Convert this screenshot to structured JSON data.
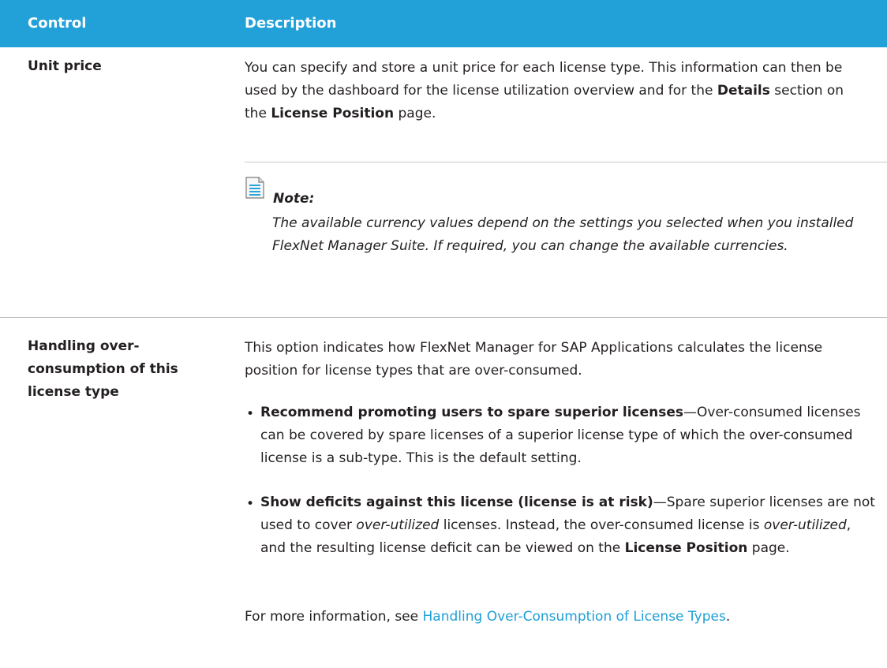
{
  "header": {
    "col_control": "Control",
    "col_description": "Description"
  },
  "row1": {
    "label": "Unit price",
    "desc_part1": "You can specify and store a unit price for each license type. This information can then be used by the dashboard for the license utilization overview and for the ",
    "desc_bold1": "Details",
    "desc_part2": " section on the ",
    "desc_bold2": "License Position",
    "desc_part3": " page.",
    "note": {
      "icon": "note-icon",
      "title": "Note:",
      "body": "The available currency values depend on the settings you selected when you installed FlexNet Manager Suite. If required, you can change the available currencies."
    }
  },
  "row2": {
    "label": "Handling over-consumption of this license type",
    "desc": "This option indicates how FlexNet Manager for SAP Applications calculates the license position for license types that are over-consumed.",
    "bullets": [
      {
        "bold": "Recommend promoting users to spare superior licenses",
        "text": "—Over-consumed licenses can be covered by spare licenses of a superior license type of which the over-consumed license is a sub-type. This is the default setting."
      },
      {
        "bold": "Show deficits against this license (license is at risk)",
        "text_a": "—Spare superior licenses are not used to cover ",
        "italic_a": "over-utilized",
        "text_b": " licenses. Instead, the over-consumed license is ",
        "italic_b": "over-utilized",
        "text_c": ", and the resulting license deficit can be viewed on the ",
        "bold_end": "License Position",
        "text_d": " page."
      }
    ],
    "more_prefix": "For more information, see ",
    "more_link": "Handling Over-Consumption of License Types",
    "more_suffix": "."
  },
  "colors": {
    "header_bg": "#22a1d9",
    "link": "#1e9fd6"
  }
}
